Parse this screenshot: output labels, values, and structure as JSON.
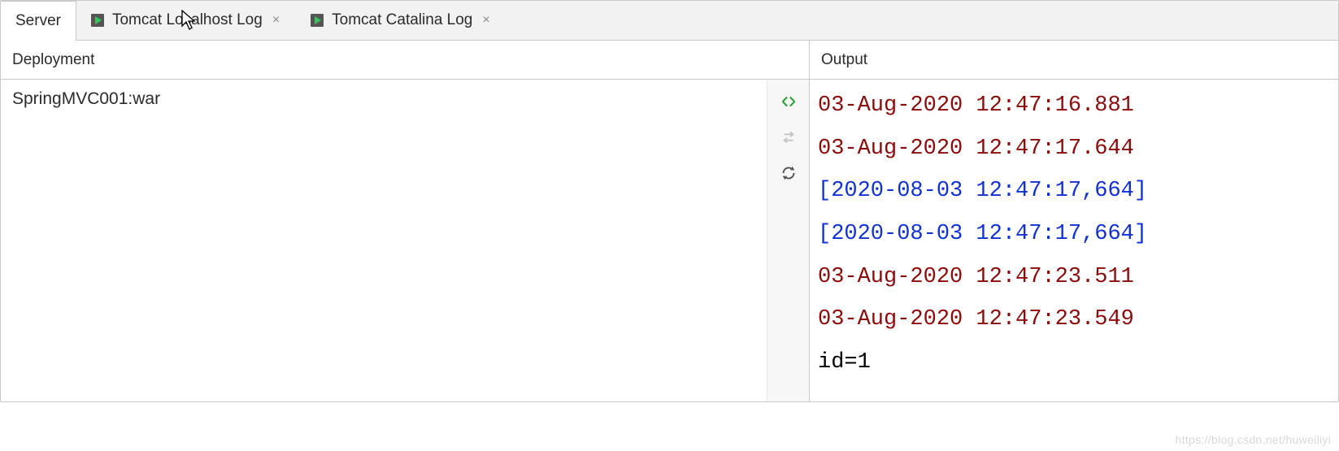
{
  "tabs": {
    "server": {
      "label": "Server"
    },
    "localhost": {
      "label": "Tomcat Localhost Log"
    },
    "catalina": {
      "label": "Tomcat Catalina Log"
    }
  },
  "panes": {
    "deployment": {
      "title": "Deployment"
    },
    "output": {
      "title": "Output"
    }
  },
  "deployment": {
    "items": [
      {
        "label": "SpringMVC001:war"
      }
    ]
  },
  "output_lines": [
    {
      "cls": "log-red",
      "text": "03-Aug-2020 12:47:16.881"
    },
    {
      "cls": "log-red",
      "text": "03-Aug-2020 12:47:17.644"
    },
    {
      "cls": "log-blue",
      "text": "[2020-08-03 12:47:17,664]"
    },
    {
      "cls": "log-blue",
      "text": "[2020-08-03 12:47:17,664]"
    },
    {
      "cls": "log-red",
      "text": "03-Aug-2020 12:47:23.511"
    },
    {
      "cls": "log-red",
      "text": "03-Aug-2020 12:47:23.549"
    },
    {
      "cls": "log-black",
      "text": "id=1"
    }
  ],
  "watermark": "https://blog.csdn.net/huweiliyi"
}
